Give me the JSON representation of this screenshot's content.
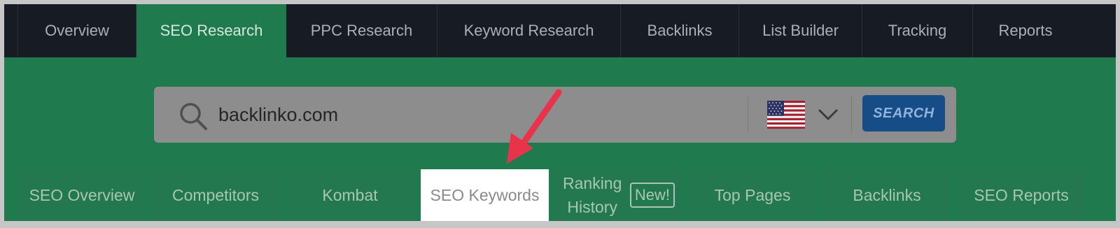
{
  "top_nav": {
    "tabs": [
      {
        "label": "Overview"
      },
      {
        "label": "SEO Research"
      },
      {
        "label": "PPC Research"
      },
      {
        "label": "Keyword Research"
      },
      {
        "label": "Backlinks"
      },
      {
        "label": "List Builder"
      },
      {
        "label": "Tracking"
      },
      {
        "label": "Reports"
      }
    ],
    "active": "SEO Research"
  },
  "search": {
    "value": "backlinko.com",
    "country_icon": "us-flag-icon",
    "button_label": "SEARCH"
  },
  "sub_nav": {
    "tabs": [
      {
        "label": "SEO Overview"
      },
      {
        "label": "Competitors"
      },
      {
        "label": "Kombat"
      },
      {
        "label": "SEO Keywords"
      },
      {
        "label_line1": "Ranking",
        "label_line2": "History",
        "badge": "New!"
      },
      {
        "label": "Top Pages"
      },
      {
        "label": "Backlinks"
      },
      {
        "label": "SEO Reports"
      }
    ],
    "active": "SEO Keywords"
  },
  "colors": {
    "nav_bg": "#171b24",
    "brand_green": "#1f7a4e",
    "search_button": "#174d86",
    "annotation_arrow": "#e8334a"
  }
}
